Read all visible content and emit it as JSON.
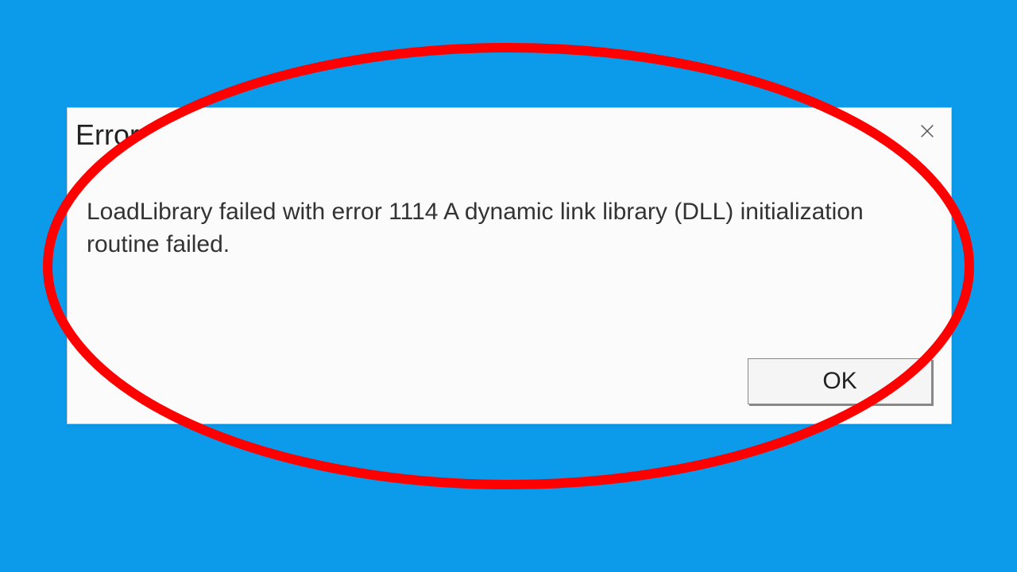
{
  "dialog": {
    "title": "Error",
    "message": "LoadLibrary failed with error 1114 A dynamic link library (DLL) initialization routine failed.",
    "ok_label": "OK"
  },
  "annotation": {
    "ellipse_color": "#ff0000"
  }
}
